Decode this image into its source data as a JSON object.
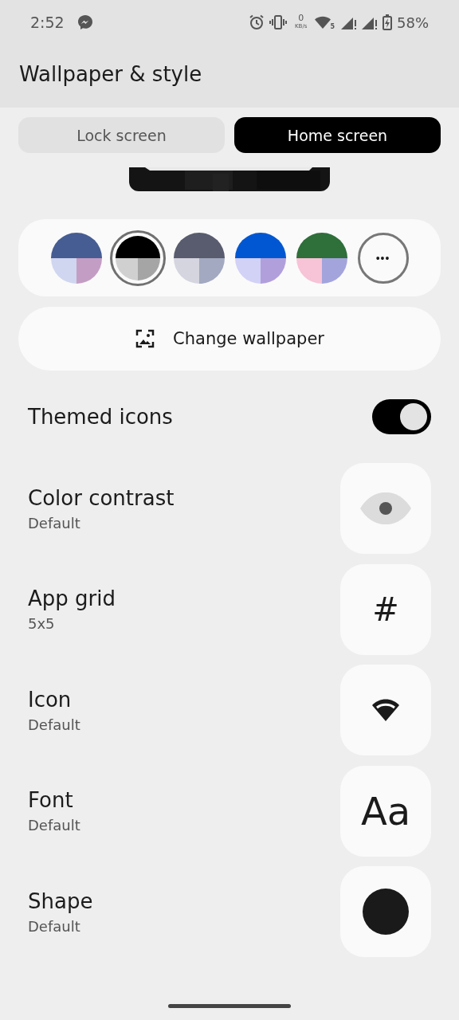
{
  "status_bar": {
    "time": "2:52",
    "net_speed": "0",
    "net_unit": "KB/s",
    "wifi_label": "5",
    "battery": "58%"
  },
  "title": "Wallpaper & style",
  "tabs": [
    {
      "label": "Lock screen",
      "selected": false
    },
    {
      "label": "Home screen",
      "selected": true
    }
  ],
  "swatches": [
    {
      "segments": [
        {
          "color": "#465d93"
        },
        {
          "color": "#d0d6ef"
        },
        {
          "color": "#c49dc4"
        }
      ],
      "selected": false
    },
    {
      "segments": [
        {
          "color": "#000000"
        },
        {
          "color": "#d0d0d0"
        },
        {
          "color": "#a5a5a5"
        }
      ],
      "selected": true
    },
    {
      "segments": [
        {
          "color": "#585c6e"
        },
        {
          "color": "#d4d5de"
        },
        {
          "color": "#a2a9c0"
        }
      ],
      "selected": false
    },
    {
      "segments": [
        {
          "color": "#0057d1"
        },
        {
          "color": "#d2d1f6"
        },
        {
          "color": "#b19fdc"
        }
      ],
      "selected": false
    },
    {
      "segments": [
        {
          "color": "#2e6f3a"
        },
        {
          "color": "#f7c3d6"
        },
        {
          "color": "#a4a4dc"
        }
      ],
      "selected": false
    }
  ],
  "more_label": "•••",
  "change_wallpaper": "Change wallpaper",
  "settings": [
    {
      "kind": "toggle",
      "title": "Themed icons",
      "on": true
    },
    {
      "kind": "option",
      "title": "Color contrast",
      "value": "Default",
      "preview": {
        "kind": "eye"
      }
    },
    {
      "kind": "option",
      "title": "App grid",
      "value": "5x5",
      "preview": {
        "kind": "text",
        "text": "#"
      }
    },
    {
      "kind": "option",
      "title": "Icon",
      "value": "Default",
      "preview": {
        "kind": "wifi"
      }
    },
    {
      "kind": "option",
      "title": "Font",
      "value": "Default",
      "preview": {
        "kind": "text",
        "text": "Aa"
      }
    },
    {
      "kind": "option",
      "title": "Shape",
      "value": "Default",
      "preview": {
        "kind": "circle"
      }
    }
  ]
}
